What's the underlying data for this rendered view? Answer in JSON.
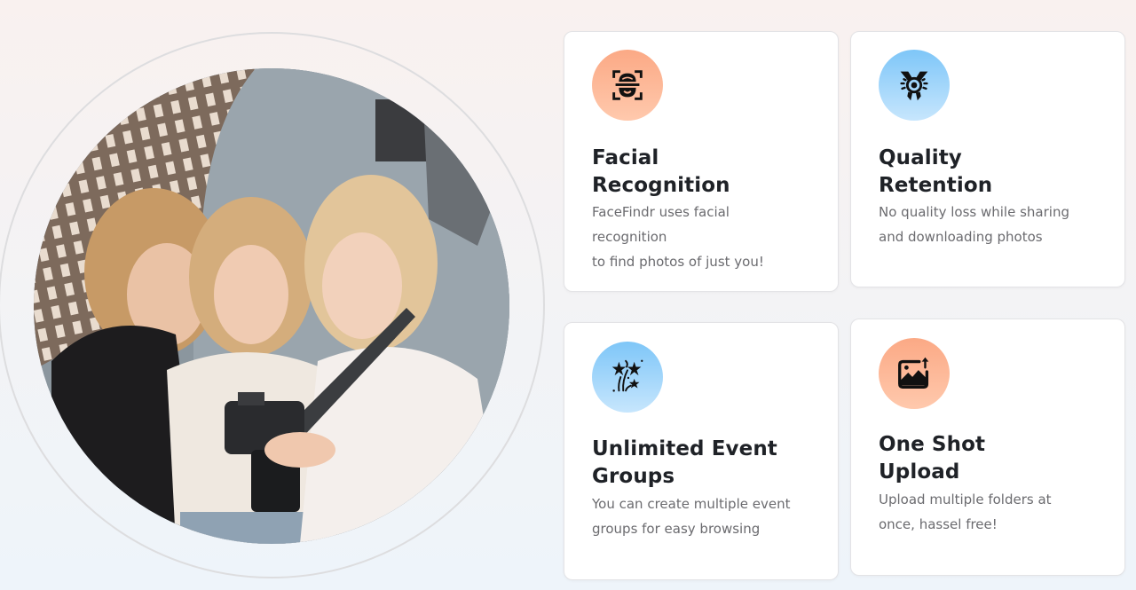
{
  "hero": {
    "image_alt": "Three smiling women looking at a photo on a DSLR camera in a studio with a softbox light"
  },
  "features": [
    {
      "icon": "face-scan-icon",
      "icon_color": "#fbb090",
      "title": "Facial\nRecognition",
      "description": "FaceFindr uses facial\nrecognition\nto find photos of just you!"
    },
    {
      "icon": "quality-badge-icon",
      "icon_color": "#8fcdf9",
      "title": "Quality\nRetention",
      "description": "No quality loss while sharing\nand downloading photos"
    },
    {
      "icon": "fireworks-stars-icon",
      "icon_color": "#8fcdf9",
      "title": "Unlimited Event\nGroups",
      "description": "You can create multiple event\ngroups for easy browsing"
    },
    {
      "icon": "image-upload-icon",
      "icon_color": "#fbb090",
      "title": "One Shot\nUpload",
      "description": "Upload multiple folders at\nonce, hassel free!"
    }
  ]
}
